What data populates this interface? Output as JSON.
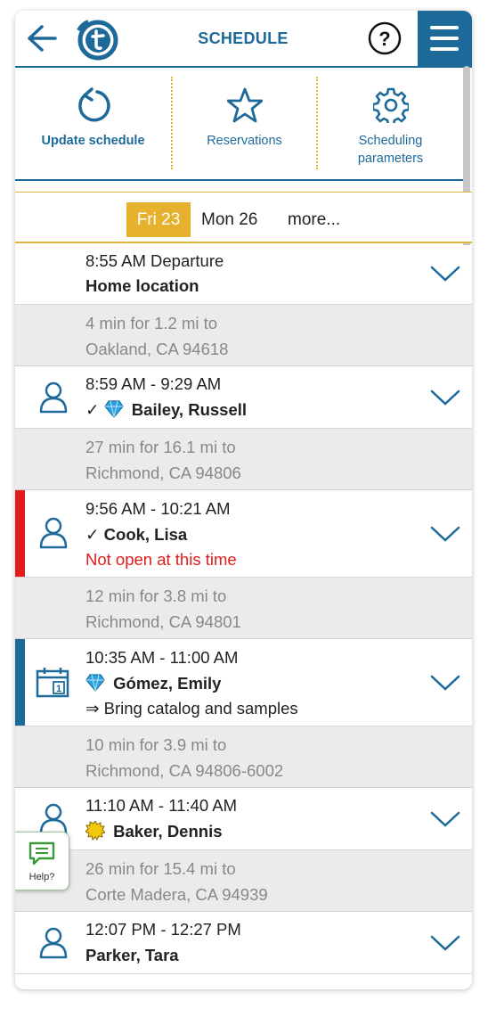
{
  "header": {
    "title": "SCHEDULE"
  },
  "toolbar": {
    "update_label": "Update schedule",
    "reservations_label": "Reservations",
    "params_label_1": "Scheduling",
    "params_label_2": "parameters"
  },
  "dates": {
    "active": "Fri 23",
    "second": "Mon 26",
    "more": "more..."
  },
  "stops": [
    {
      "time": "8:55 AM Departure",
      "name": "Home location",
      "travel1": "4 min for 1.2 mi to",
      "travel2": "Oakland, CA 94618"
    },
    {
      "time": "8:59 AM - 9:29 AM",
      "check": "✓",
      "name": "Bailey, Russell",
      "travel1": "27 min for 16.1 mi to",
      "travel2": "Richmond, CA 94806"
    },
    {
      "time": "9:56 AM - 10:21 AM",
      "check": "✓",
      "name": "Cook, Lisa",
      "note": "Not open at this time",
      "travel1": "12 min for 3.8 mi to",
      "travel2": "Richmond, CA 94801"
    },
    {
      "time": "10:35 AM - 11:00 AM",
      "name": "Gómez, Emily",
      "note": "⇒ Bring catalog and samples",
      "travel1": "10 min for 3.9 mi to",
      "travel2": "Richmond, CA 94806-6002"
    },
    {
      "time": "11:10 AM - 11:40 AM",
      "name": "Baker, Dennis",
      "travel1": "26 min for 15.4 mi to",
      "travel2": "Corte Madera, CA 94939"
    },
    {
      "time": "12:07 PM - 12:27 PM",
      "name": "Parker, Tara"
    }
  ],
  "help_widget": {
    "label": "Help?"
  },
  "colors": {
    "primary": "#1d6a9a",
    "accent": "#e6b22e",
    "alert": "#e01c1c",
    "gem": "#2aa3e0"
  },
  "icons": [
    "back-arrow-icon",
    "logo-icon",
    "help-icon",
    "hamburger-menu-icon",
    "refresh-icon",
    "star-icon",
    "gear-icon",
    "person-icon",
    "calendar-icon",
    "diamond-icon",
    "sun-icon",
    "chevron-down-icon",
    "chat-icon"
  ]
}
